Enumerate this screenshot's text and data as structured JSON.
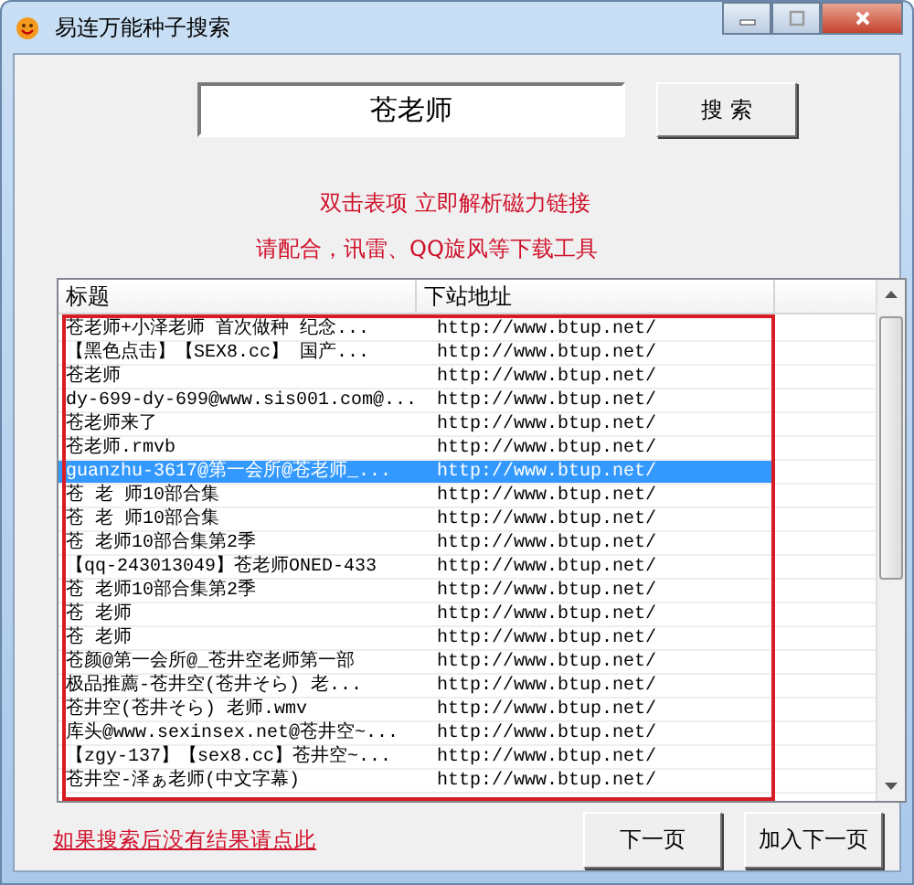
{
  "window": {
    "title": "易连万能种子搜索"
  },
  "search": {
    "value": "苍老师",
    "button": "搜 索"
  },
  "hints": [
    "双击表项 立即解析磁力链接",
    "请配合，讯雷、QQ旋风等下载工具"
  ],
  "table": {
    "columns": [
      "标题",
      "下站地址"
    ],
    "rows": [
      {
        "title": "苍老师+小泽老师 首次做种 纪念...",
        "url": "http://www.btup.net/",
        "selected": false
      },
      {
        "title": "【黑色点击】【SEX8.cc】 国产...",
        "url": "http://www.btup.net/",
        "selected": false
      },
      {
        "title": "苍老师",
        "url": "http://www.btup.net/",
        "selected": false
      },
      {
        "title": "dy-699-dy-699@www.sis001.com@...",
        "url": "http://www.btup.net/",
        "selected": false
      },
      {
        "title": "苍老师来了",
        "url": "http://www.btup.net/",
        "selected": false
      },
      {
        "title": "苍老师.rmvb",
        "url": "http://www.btup.net/",
        "selected": false
      },
      {
        "title": "guanzhu-3617@第一会所@苍老师_...",
        "url": "http://www.btup.net/",
        "selected": true
      },
      {
        "title": "苍 老 师10部合集",
        "url": "http://www.btup.net/",
        "selected": false
      },
      {
        "title": "苍 老 师10部合集",
        "url": "http://www.btup.net/",
        "selected": false
      },
      {
        "title": "苍 老师10部合集第2季",
        "url": "http://www.btup.net/",
        "selected": false
      },
      {
        "title": "【qq-243013049】苍老师ONED-433",
        "url": "http://www.btup.net/",
        "selected": false
      },
      {
        "title": "苍 老师10部合集第2季",
        "url": "http://www.btup.net/",
        "selected": false
      },
      {
        "title": "苍 老师",
        "url": "http://www.btup.net/",
        "selected": false
      },
      {
        "title": "苍 老师",
        "url": "http://www.btup.net/",
        "selected": false
      },
      {
        "title": "苍颜@第一会所@_苍井空老师第一部",
        "url": "http://www.btup.net/",
        "selected": false
      },
      {
        "title": "极品推薦-苍井空(苍井そら) 老...",
        "url": "http://www.btup.net/",
        "selected": false
      },
      {
        "title": "苍井空(苍井そら) 老师.wmv",
        "url": "http://www.btup.net/",
        "selected": false
      },
      {
        "title": "库头@www.sexinsex.net@苍井空~...",
        "url": "http://www.btup.net/",
        "selected": false
      },
      {
        "title": "【zgy-137】【sex8.cc】苍井空~...",
        "url": "http://www.btup.net/",
        "selected": false
      },
      {
        "title": "苍井空-泽ぁ老师(中文字幕)",
        "url": "http://www.btup.net/",
        "selected": false
      }
    ]
  },
  "link": "如果搜索后没有结果请点此",
  "buttons": [
    "下一页",
    "加入下一页"
  ]
}
